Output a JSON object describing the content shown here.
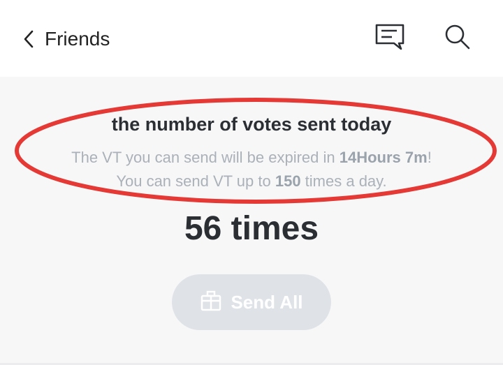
{
  "header": {
    "back_label": "Friends",
    "icons": [
      "chevron-left-icon",
      "message-icon",
      "search-icon"
    ]
  },
  "info": {
    "heading": "the number of votes sent today",
    "line1_prefix": "The VT you can send will be expired in ",
    "line1_bold": "14Hours 7m",
    "line1_suffix": "!",
    "line2_prefix": "You can send VT up to ",
    "line2_bold": "150",
    "line2_suffix": " times a day."
  },
  "count": "56 times",
  "send_button": {
    "label": "Send All",
    "icon": "gift-box-icon"
  },
  "colors": {
    "annotation_red": "#e53935",
    "button_bg": "#dfe3e7",
    "subtext": "#aab1b8",
    "heading": "#2b2f33"
  }
}
